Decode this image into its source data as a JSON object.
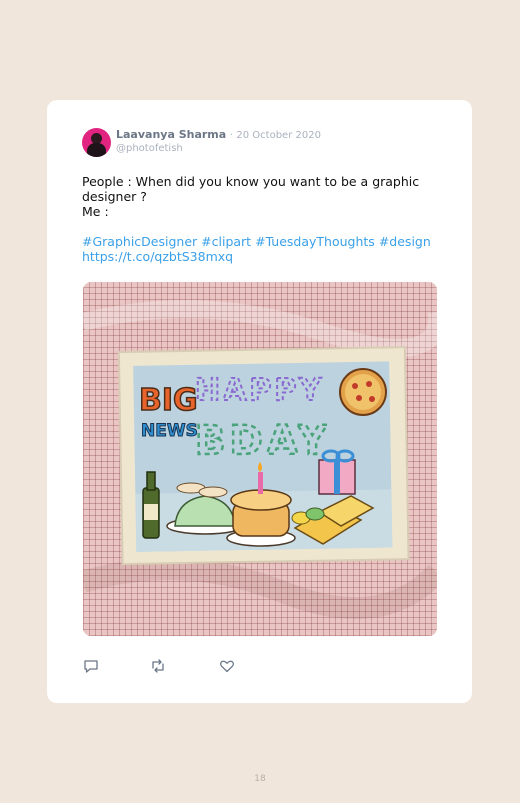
{
  "tweet": {
    "author_name": "Laavanya Sharma",
    "separator": "·",
    "date": "20 October 2020",
    "handle": "@photofetish",
    "text_line1": "People : When did you know you want to be a graphic designer ?",
    "text_line2": "Me :",
    "hashtags": [
      "#GraphicDesigner",
      "#clipart",
      "#TuesdayThoughts",
      "#design"
    ],
    "link": "https://t.co/qzbtS38mxq"
  },
  "media": {
    "description_icon": "image",
    "artwork_text": {
      "big": "BIG",
      "news": "NEWS",
      "happy": "HAPPY",
      "bday": "BDAY"
    }
  },
  "actions": {
    "reply_icon": "reply-icon",
    "retweet_icon": "retweet-icon",
    "like_icon": "heart-icon"
  },
  "page": {
    "number": "18"
  },
  "colors": {
    "background": "#f1e6dc",
    "card": "#ffffff",
    "link": "#3aa0e8",
    "name": "#6b7687",
    "muted": "#a9b2bd"
  }
}
